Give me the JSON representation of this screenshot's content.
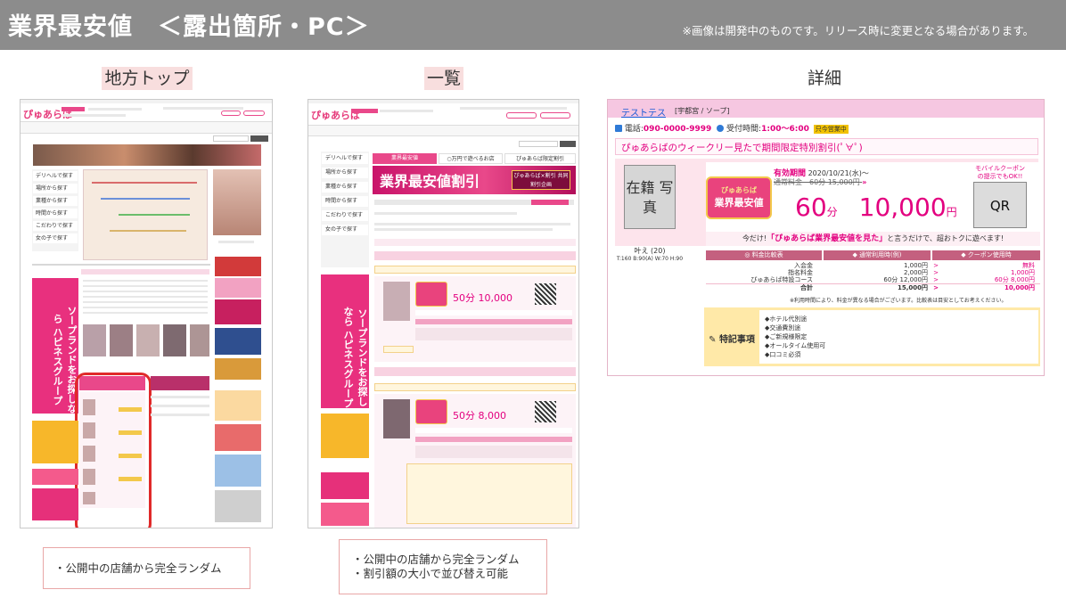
{
  "header": {
    "title": "業界最安値　＜露出箇所・PC＞",
    "note": "※画像は開発中のものです。リリース時に変更となる場合があります。"
  },
  "sections": {
    "regional_top": {
      "label": "地方トップ"
    },
    "list": {
      "label": "一覧"
    },
    "detail": {
      "label": "詳細"
    }
  },
  "mini": {
    "logo": "ぴゅあらば",
    "menu_delivery": "デリヘルで探す",
    "menu_area": "場所から探す",
    "menu_genre": "業種から探す",
    "menu_time": "時間から探す",
    "menu_kodawari": "こだわりで探す",
    "menu_girl": "女の子で探す",
    "banner_happiness": "ソープランドをお探しなら ハピネスグループ",
    "banner_lowest": "業界最安値割引",
    "banner_coupon": "ぴゅあらば×割引 共同割引企画",
    "tab_list": "業界最安値",
    "tab_price": "○万円で遊べるお店",
    "tab_limited": "ぴゅあらば限定割引",
    "price_1": "10,000",
    "price_2": "8,000",
    "unit_min": "50分",
    "qr": "QR"
  },
  "detail": {
    "shop_name": "テストテス",
    "area": "[宇都宮 / ソープ]",
    "tel_label": "電話:",
    "tel": "090-0000-9999",
    "hours_label": "受付時間:",
    "hours": "1:00〜6:00",
    "open_badge": "只今営業中",
    "campaign": "ぴゅあらばのウィークリー見たで期間限定特別割引(ﾟ∀ﾟ)",
    "zaiseki": "在籍 写真",
    "girl_name": "叶え (20)",
    "girl_spec": "T:160 B:90(A) W:70 H:90",
    "emblem_top": "ぴゅあらば",
    "emblem_bottom": "業界最安値",
    "period_label": "有効期間",
    "period": "2020/10/21(水)〜",
    "regular": "通常料金　60分 15,000円",
    "minutes": "60",
    "minutes_unit": "分",
    "price": "10,000",
    "price_unit": "円",
    "mobile_coupon": "モバイルクーポン の提示でもOK!!",
    "qr": "QR",
    "today_msg_a": "今だけ!",
    "today_msg_b": "「ぴゅあらば業界最安値を見た」",
    "today_msg_c": "と言うだけで、超おトクに遊べます!",
    "table_h1": "料金比較表",
    "table_h2": "通常利用時(例)",
    "table_h3": "クーポン使用時",
    "rows": [
      {
        "label": "入会金",
        "normal": "1,000円",
        "coupon": "無料"
      },
      {
        "label": "指名料金",
        "normal": "2,000円",
        "coupon": "1,000円"
      },
      {
        "label": "ぴゅあらば特設コース",
        "normal": "60分 12,000円",
        "coupon": "60分 8,000円"
      },
      {
        "label": "合計",
        "normal": "15,000円",
        "coupon": "10,000円"
      }
    ],
    "footnote": "※利用時間により、料金が異なる場合がございます。比較表は目安としてお考えください。",
    "feature_label": "特記事項",
    "features": [
      "◆ホテル代別途",
      "◆交通費別途",
      "◆ご新規様限定",
      "◆オールタイム使用可",
      "◆口コミ必須"
    ]
  },
  "notes": {
    "top": "・公開中の店舗から完全ランダム",
    "list_1": "・公開中の店舗から完全ランダム",
    "list_2": "・割引額の大小で並び替え可能"
  }
}
